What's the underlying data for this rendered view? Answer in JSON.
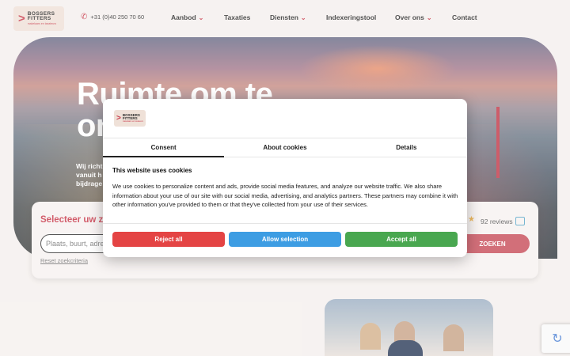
{
  "header": {
    "logo": {
      "line1": "BOSSERS",
      "line2": "FITTERS",
      "tagline": "makelaars en taxateurs"
    },
    "phone": "+31 (0)40 250 70 60",
    "nav": [
      {
        "label": "Aanbod",
        "dropdown": true
      },
      {
        "label": "Taxaties",
        "dropdown": false
      },
      {
        "label": "Diensten",
        "dropdown": true
      },
      {
        "label": "Indexeringstool",
        "dropdown": false
      },
      {
        "label": "Over ons",
        "dropdown": true
      },
      {
        "label": "Contact",
        "dropdown": false
      }
    ]
  },
  "hero": {
    "title": "Ruimte om te on",
    "subtitle_lines": [
      "Wij richt",
      "vanuit h",
      "bijdrage"
    ]
  },
  "search": {
    "title": "Selecteer uw zo",
    "placeholder": "Plaats, buurt, adre",
    "reset": "Reset zoekcriteria",
    "reviews": "92 reviews",
    "button": "ZOEKEN"
  },
  "consent": {
    "logo": {
      "line1": "BOSSERS",
      "line2": "FITTERS",
      "tagline": "makelaars en taxateurs"
    },
    "tabs": [
      {
        "label": "Consent",
        "active": true
      },
      {
        "label": "About cookies",
        "active": false
      },
      {
        "label": "Details",
        "active": false
      }
    ],
    "heading": "This website uses cookies",
    "body": "We use cookies to personalize content and ads, provide social media features, and analyze our website traffic. We also share information about your use of our site with our social media, advertising, and analytics partners. These partners may combine it with other information you've provided to them or that they've collected from your use of their services.",
    "buttons": {
      "reject": "Reject all",
      "selection": "Allow selection",
      "accept": "Accept all"
    },
    "colors": {
      "reject": "#e44444",
      "selection": "#3d9de3",
      "accept": "#49a750"
    }
  },
  "colors": {
    "brand": "#c8394a",
    "background": "#f5f0ee"
  },
  "icons": {
    "phone": "phone-icon",
    "caret": "chevron-down-icon",
    "star": "star-icon",
    "reviews": "chat-bubbles-icon",
    "captcha": "recaptcha-icon"
  }
}
